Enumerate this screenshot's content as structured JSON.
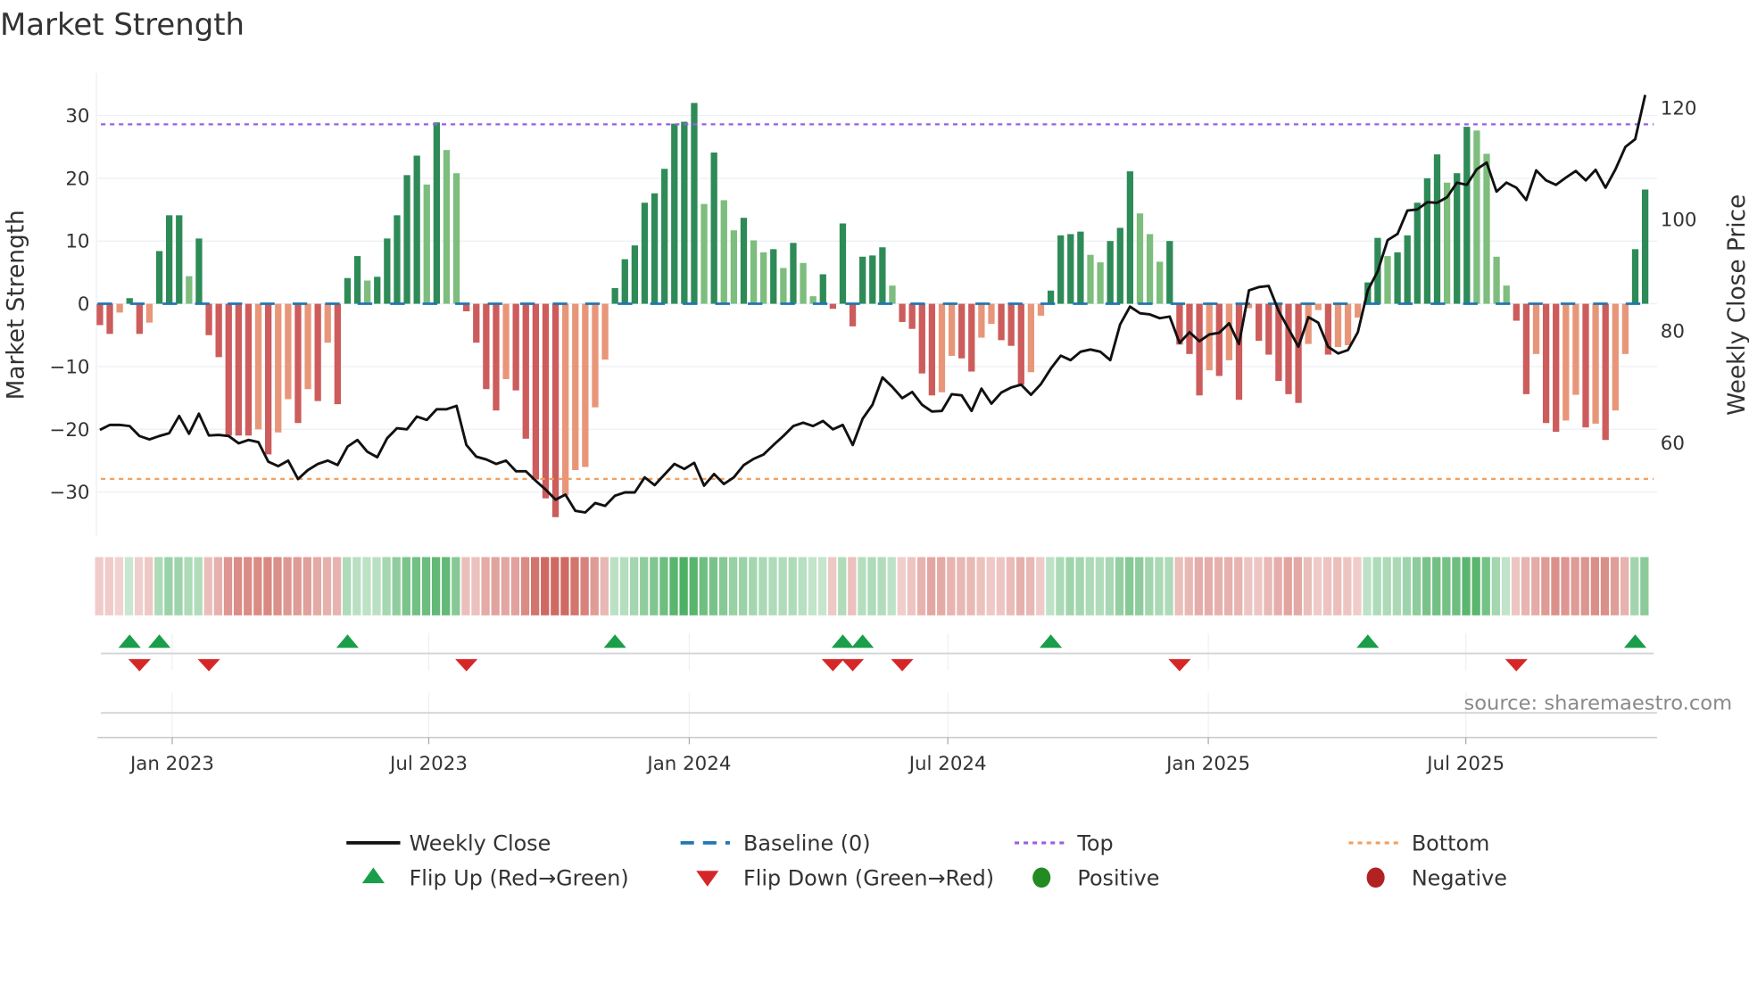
{
  "title": "Market Strength",
  "source": "source: sharemaestro.com",
  "colors": {
    "pos_strong": "#2e8b57",
    "pos_weak": "#7dbd7d",
    "neg_strong": "#cd5c5c",
    "neg_weak": "#e8967a",
    "line": "#111111",
    "baseline": "#1f77b4",
    "top": "#9b5de5",
    "bottom": "#f0a060",
    "flip_up": "#1a9e4a",
    "flip_down": "#d62728",
    "positive": "#228b22",
    "negative": "#b22222",
    "grid": "#eceff5"
  },
  "chart_data": {
    "type": "bar",
    "title": "Market Strength",
    "ylabel": "Market Strength",
    "y2label": "Weekly Close Price",
    "ylim": [
      -37,
      36
    ],
    "y2lim": [
      45,
      123
    ],
    "yticks": [
      30,
      20,
      10,
      0,
      -10,
      -20,
      -30
    ],
    "ytick_labels": [
      "30",
      "20",
      "10",
      "0",
      "−10",
      "−20",
      "−30"
    ],
    "y2ticks": [
      120,
      100,
      80,
      60
    ],
    "y2tick_labels": [
      "120",
      "100",
      "80",
      "60"
    ],
    "xticks": [
      {
        "label": "Jan 2023",
        "week": 7.3
      },
      {
        "label": "Jul 2023",
        "week": 33.2
      },
      {
        "label": "Jan 2024",
        "week": 59.5
      },
      {
        "label": "Jul 2024",
        "week": 85.6
      },
      {
        "label": "Jan 2025",
        "week": 111.9
      },
      {
        "label": "Jul 2025",
        "week": 137.9
      }
    ],
    "top_level": 28.6,
    "bottom_level": -27.9,
    "baseline": 0,
    "strength": [
      -3.4,
      -4.8,
      -1.4,
      0.9,
      -4.8,
      -3.0,
      8.4,
      14.1,
      14.1,
      4.4,
      10.4,
      -5.0,
      -8.5,
      -21,
      -21,
      -21,
      -20,
      -24,
      -20.5,
      -15.2,
      -19,
      -13.6,
      -15.5,
      -6.2,
      -16,
      4.1,
      7.6,
      3.7,
      4.3,
      10.4,
      14.1,
      20.5,
      23.6,
      19,
      28.9,
      24.5,
      20.8,
      -1.2,
      -6.2,
      -13.6,
      -17,
      -12,
      -13.8,
      -21.5,
      -28,
      -31,
      -34,
      -30.5,
      -26.5,
      -26,
      -16.5,
      -8.9,
      2.5,
      7.1,
      9.3,
      16.1,
      17.6,
      21.5,
      28.7,
      29,
      32,
      15.9,
      24.1,
      16.5,
      11.7,
      13.7,
      10.1,
      8.2,
      8.7,
      5.7,
      9.7,
      6.5,
      1.2,
      4.7,
      -0.8,
      12.8,
      -3.6,
      7.5,
      7.7,
      9.0,
      2.9,
      -2.9,
      -4,
      -11.1,
      -14.6,
      -14.1,
      -8.3,
      -8.7,
      -10.8,
      -5.4,
      -3.2,
      -5.8,
      -6.7,
      -12.9,
      -10.9,
      -1.9,
      2.1,
      10.9,
      11.1,
      11.5,
      7.8,
      6.6,
      10,
      12.1,
      21.1,
      14.4,
      11.1,
      6.7,
      10,
      -6.5,
      -8.0,
      -14.6,
      -10.6,
      -11.5,
      -9.0,
      -15.3,
      -0.7,
      -5.9,
      -8.1,
      -12.3,
      -14.4,
      -15.8,
      -6.4,
      -1.0,
      -8.1,
      -6.9,
      -6.6,
      -2.2,
      3.4,
      10.5,
      7.6,
      8.2,
      10.9,
      16.1,
      20,
      23.8,
      19.3,
      20.8,
      28.2,
      27.6,
      23.9,
      7.5,
      2.9,
      -2.7,
      -14.4,
      -8,
      -19,
      -20.4,
      -18.6,
      -14.5,
      -19.7,
      -19.1,
      -21.7,
      -17,
      -8,
      8.7,
      18.2
    ],
    "weekly_close": [
      62.1,
      63,
      63,
      62.8,
      61,
      60.4,
      61,
      61.5,
      64.6,
      61.4,
      65,
      61.1,
      61.2,
      61,
      59.7,
      60.3,
      59.9,
      56.4,
      55.6,
      56.6,
      53.3,
      54.9,
      56,
      56.6,
      55.8,
      59.1,
      60.3,
      58.2,
      57.2,
      60.6,
      62.4,
      62.2,
      64.5,
      63.9,
      65.8,
      65.8,
      66.4,
      59.4,
      57.3,
      56.8,
      56,
      56.6,
      54.7,
      54.7,
      53,
      51.4,
      49.6,
      50.5,
      47.6,
      47.3,
      49,
      48.5,
      50.3,
      50.9,
      50.9,
      53.6,
      52.2,
      54.1,
      56,
      55.1,
      56.2,
      52.1,
      54.2,
      52.4,
      53.6,
      55.8,
      56.9,
      57.7,
      59.4,
      61,
      62.8,
      63.4,
      62.8,
      63.7,
      62.2,
      63,
      59.4,
      64.1,
      66.6,
      71.5,
      69.8,
      67.8,
      68.9,
      66.6,
      65.4,
      65.5,
      68.5,
      68.3,
      65.5,
      69.5,
      66.8,
      68.8,
      69.7,
      70.2,
      68.4,
      70.3,
      73.1,
      75.4,
      74.6,
      76.1,
      76.5,
      76.1,
      74.6,
      81,
      84.2,
      83,
      82.8,
      82.1,
      82.4,
      77.7,
      79.6,
      78,
      79.2,
      79.5,
      81.2,
      77.5,
      87.1,
      87.7,
      87.9,
      83.4,
      80.2,
      77,
      82.3,
      81.3,
      77,
      75.8,
      76.4,
      79.6,
      87.1,
      90.5,
      96.1,
      97.2,
      101.4,
      101.6,
      102.9,
      102.8,
      103.8,
      106.4,
      106,
      108.8,
      110,
      104.8,
      106.4,
      105.5,
      103.3,
      108.6,
      106.8,
      106,
      107.3,
      108.5,
      106.8,
      108.7,
      105.5,
      108.8,
      112.8,
      114.2,
      122.1
    ],
    "flip_up_weeks": [
      3,
      6,
      25,
      52,
      75,
      77,
      96,
      128,
      155
    ],
    "flip_down_weeks": [
      4,
      11,
      37,
      74,
      76,
      81,
      109,
      143
    ]
  },
  "legend": [
    {
      "key": "weekly_close",
      "label": "Weekly Close"
    },
    {
      "key": "baseline",
      "label": "Baseline (0)"
    },
    {
      "key": "top",
      "label": "Top"
    },
    {
      "key": "bottom",
      "label": "Bottom"
    },
    {
      "key": "flip_up",
      "label": "Flip Up (Red→Green)"
    },
    {
      "key": "flip_down",
      "label": "Flip Down (Green→Red)"
    },
    {
      "key": "positive",
      "label": "Positive"
    },
    {
      "key": "negative",
      "label": "Negative"
    }
  ]
}
